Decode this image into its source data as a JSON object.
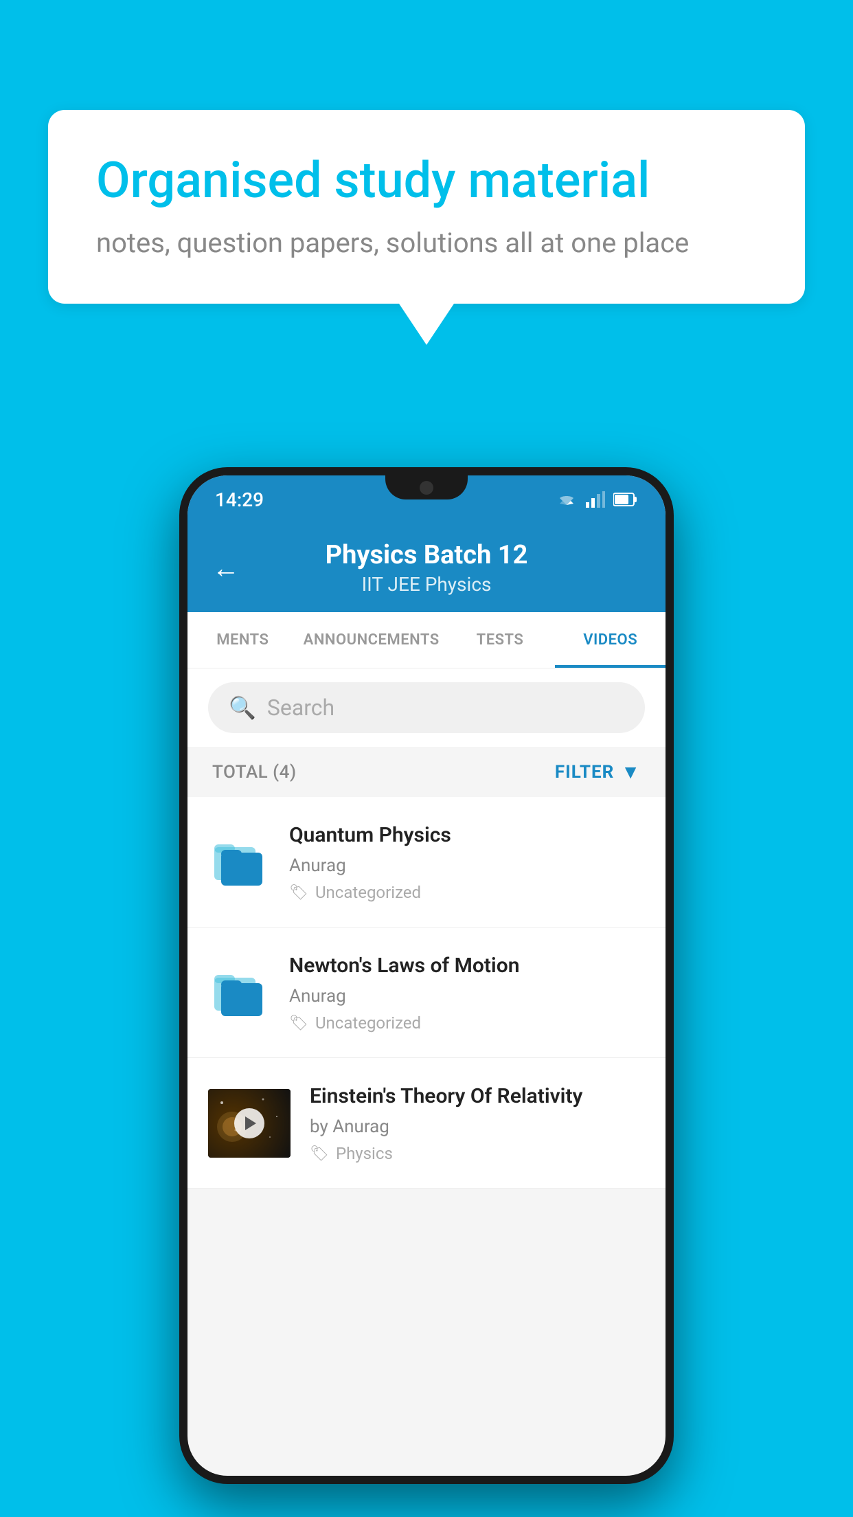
{
  "background_color": "#00BFEA",
  "speech_bubble": {
    "title": "Organised study material",
    "subtitle": "notes, question papers, solutions all at one place"
  },
  "status_bar": {
    "time": "14:29"
  },
  "app_header": {
    "title": "Physics Batch 12",
    "subtitle": "IIT JEE   Physics",
    "back_icon": "←"
  },
  "tabs": [
    {
      "label": "MENTS",
      "active": false
    },
    {
      "label": "ANNOUNCEMENTS",
      "active": false
    },
    {
      "label": "TESTS",
      "active": false
    },
    {
      "label": "VIDEOS",
      "active": true
    }
  ],
  "search": {
    "placeholder": "Search"
  },
  "filter_row": {
    "total": "TOTAL (4)",
    "filter_label": "FILTER"
  },
  "videos": [
    {
      "id": 1,
      "title": "Quantum Physics",
      "author": "Anurag",
      "tag": "Uncategorized",
      "has_thumbnail": false
    },
    {
      "id": 2,
      "title": "Newton's Laws of Motion",
      "author": "Anurag",
      "tag": "Uncategorized",
      "has_thumbnail": false
    },
    {
      "id": 3,
      "title": "Einstein's Theory Of Relativity",
      "author": "by Anurag",
      "tag": "Physics",
      "has_thumbnail": true
    }
  ]
}
